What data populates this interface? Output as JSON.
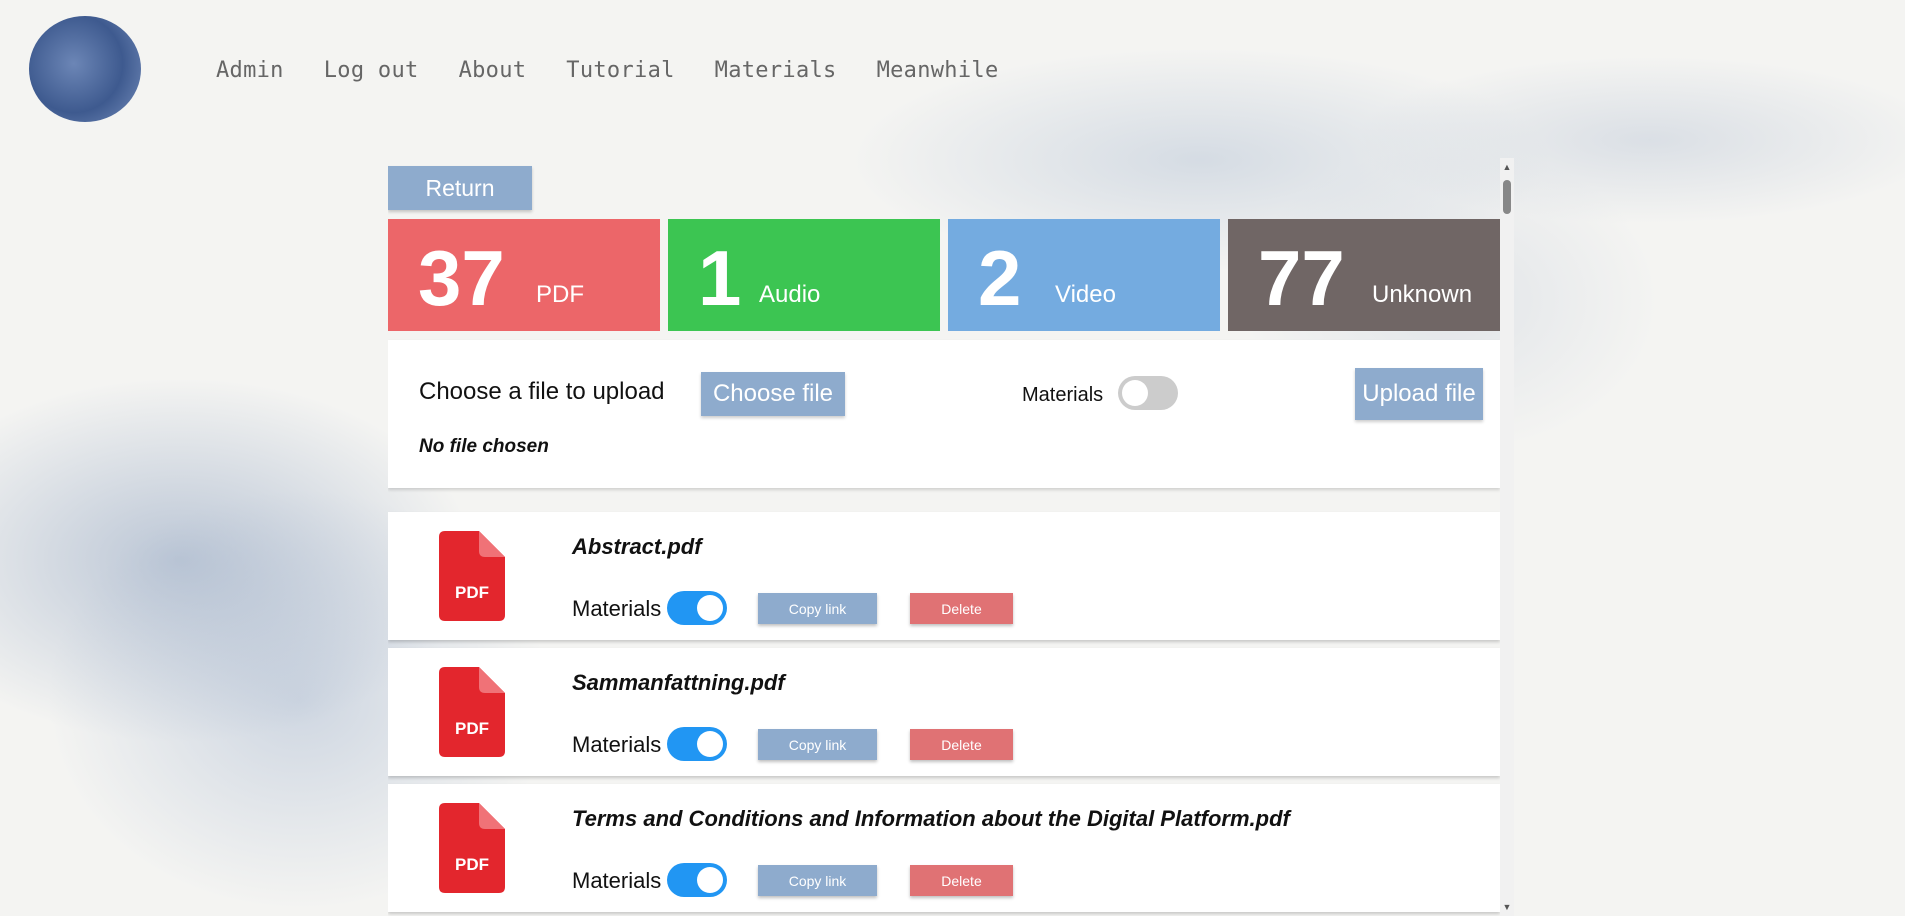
{
  "nav": {
    "items": [
      "Admin",
      "Log out",
      "About",
      "Tutorial",
      "Materials",
      "Meanwhile"
    ]
  },
  "return_label": "Return",
  "stats": [
    {
      "count": "37",
      "label": "PDF",
      "color": "#ec6669"
    },
    {
      "count": "1",
      "label": "Audio",
      "color": "#3cc552"
    },
    {
      "count": "2",
      "label": "Video",
      "color": "#74abe0"
    },
    {
      "count": "77",
      "label": "Unknown",
      "color": "#706665"
    }
  ],
  "upload": {
    "label": "Choose a file to upload",
    "choose_label": "Choose file",
    "no_file": "No file chosen",
    "materials_label": "Materials",
    "materials_on": false,
    "upload_label": "Upload file"
  },
  "files": [
    {
      "name": "Abstract.pdf",
      "icon": "pdf-icon",
      "icon_text": "PDF",
      "materials_label": "Materials",
      "materials_on": true,
      "copy_label": "Copy link",
      "delete_label": "Delete"
    },
    {
      "name": "Sammanfattning.pdf",
      "icon": "pdf-icon",
      "icon_text": "PDF",
      "materials_label": "Materials",
      "materials_on": true,
      "copy_label": "Copy link",
      "delete_label": "Delete"
    },
    {
      "name": "Terms and Conditions and Information about the Digital Platform.pdf",
      "icon": "pdf-icon",
      "icon_text": "PDF",
      "materials_label": "Materials",
      "materials_on": true,
      "copy_label": "Copy link",
      "delete_label": "Delete"
    }
  ]
}
